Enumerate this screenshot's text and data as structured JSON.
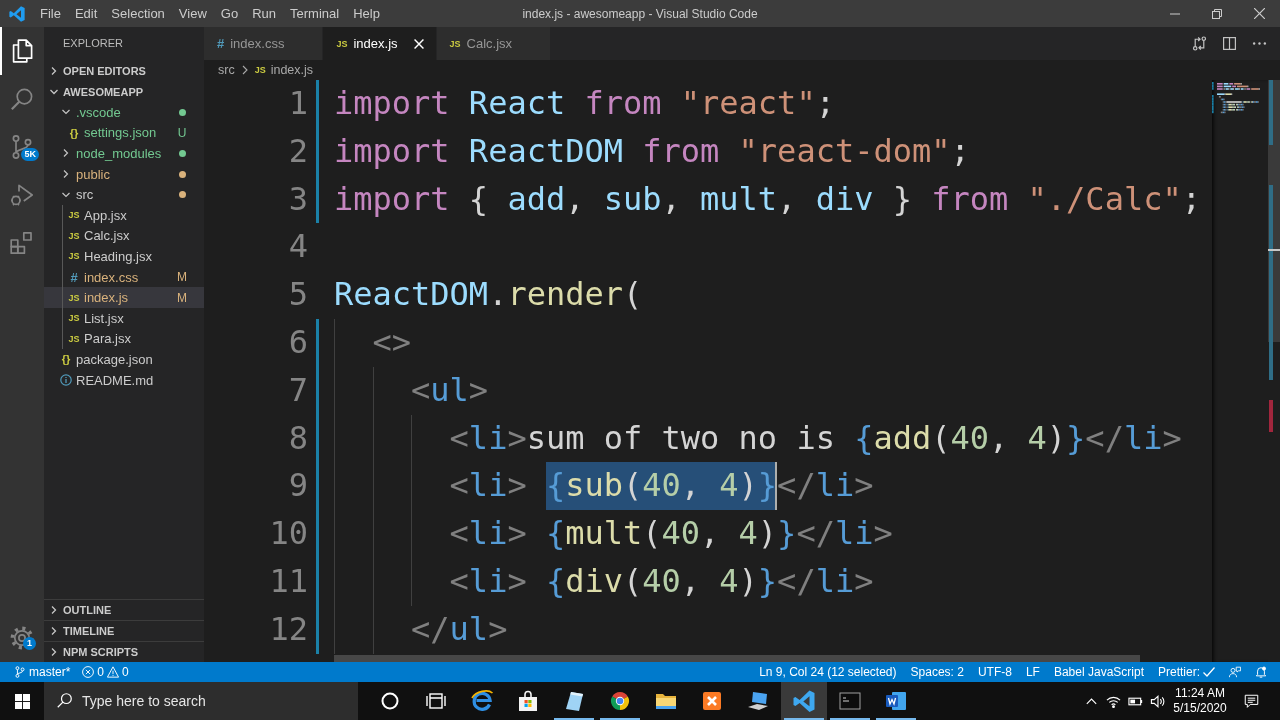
{
  "title_bar": {
    "menus": [
      "File",
      "Edit",
      "Selection",
      "View",
      "Go",
      "Run",
      "Terminal",
      "Help"
    ],
    "title": "index.js - awesomeapp - Visual Studio Code"
  },
  "activity_bar": {
    "top": [
      {
        "kind": "explorer",
        "selected": true
      },
      {
        "kind": "search",
        "selected": false
      },
      {
        "kind": "source-control",
        "selected": false,
        "badge": "5K"
      },
      {
        "kind": "run",
        "selected": false
      },
      {
        "kind": "extensions",
        "selected": false
      }
    ],
    "bottom": [
      {
        "kind": "settings",
        "selected": false,
        "badge": "1"
      }
    ]
  },
  "sidebar": {
    "title": "EXPLORER",
    "sections": [
      {
        "title": "OPEN EDITORS",
        "expanded": false
      },
      {
        "title": "AWESOMEAPP",
        "expanded": true,
        "items": [
          {
            "name": ".vscode",
            "kind": "folder",
            "expanded": true,
            "selected": false,
            "color": "#73c991",
            "dot": {
              "color": "#73c991"
            },
            "children": [
              {
                "name": "settings.json",
                "kind": "json",
                "icon": "{}",
                "selected": false,
                "color": "#73c991",
                "badge": "U"
              }
            ]
          },
          {
            "name": "node_modules",
            "kind": "folder",
            "expanded": false,
            "selected": false,
            "color": "#73c991",
            "dot": {
              "color": "#73c991"
            }
          },
          {
            "name": "public",
            "kind": "folder",
            "expanded": false,
            "selected": false,
            "color": "#d9b27c",
            "dot": {
              "color": "#d9b27c"
            }
          },
          {
            "name": "src",
            "kind": "folder",
            "expanded": true,
            "selected": false,
            "dot": {
              "color": "#d9b27c"
            },
            "children": [
              {
                "name": "App.jsx",
                "kind": "js",
                "icon": "JS",
                "selected": false
              },
              {
                "name": "Calc.jsx",
                "kind": "js",
                "icon": "JS",
                "selected": false
              },
              {
                "name": "Heading.jsx",
                "kind": "js",
                "icon": "JS",
                "selected": false
              },
              {
                "name": "index.css",
                "kind": "css",
                "icon": "#",
                "selected": false,
                "color": "#d9b27c",
                "badge": "M"
              },
              {
                "name": "index.js",
                "kind": "js",
                "icon": "JS",
                "selected": true,
                "color": "#d9b27c",
                "badge": "M"
              },
              {
                "name": "List.jsx",
                "kind": "js",
                "icon": "JS",
                "selected": false
              },
              {
                "name": "Para.jsx",
                "kind": "js",
                "icon": "JS",
                "selected": false
              }
            ]
          },
          {
            "name": "package.json",
            "kind": "json",
            "icon": "{}",
            "selected": false
          },
          {
            "name": "README.md",
            "kind": "info",
            "selected": false
          }
        ]
      },
      {
        "title": "OUTLINE",
        "expanded": false
      },
      {
        "title": "TIMELINE",
        "expanded": false
      },
      {
        "title": "NPM SCRIPTS",
        "expanded": false
      }
    ]
  },
  "editor": {
    "tabs": [
      {
        "icon": "#",
        "kind": "css",
        "label": "index.css",
        "selected": false
      },
      {
        "icon": "JS",
        "kind": "js",
        "label": "index.js",
        "selected": true
      },
      {
        "icon": "JS",
        "kind": "js",
        "label": "Calc.jsx",
        "selected": false
      }
    ],
    "actions": [
      {
        "kind": "compare"
      },
      {
        "kind": "split"
      },
      {
        "kind": "more"
      }
    ],
    "breadcrumb": [
      {
        "label": "src",
        "kind": "folder"
      },
      {
        "label": "index.js",
        "kind": "js",
        "icon": "JS"
      }
    ],
    "lines": [
      {
        "number": "1",
        "changed": true,
        "parts": [
          {
            "selected": false,
            "tokens": [
              {
                "text": "import",
                "kind": "keyword"
              },
              {
                "text": " React",
                "kind": "variable"
              },
              {
                "text": " from",
                "kind": "keyword"
              },
              {
                "text": " \"react\"",
                "kind": "string"
              },
              {
                "text": ";",
                "kind": "punct"
              }
            ]
          }
        ]
      },
      {
        "number": "2",
        "changed": true,
        "parts": [
          {
            "selected": false,
            "tokens": [
              {
                "text": "import",
                "kind": "keyword"
              },
              {
                "text": " ReactDOM",
                "kind": "variable"
              },
              {
                "text": " from",
                "kind": "keyword"
              },
              {
                "text": " \"react-dom\"",
                "kind": "string"
              },
              {
                "text": ";",
                "kind": "punct"
              }
            ]
          }
        ]
      },
      {
        "number": "3",
        "changed": true,
        "parts": [
          {
            "selected": false,
            "tokens": [
              {
                "text": "import",
                "kind": "keyword"
              },
              {
                "text": " {",
                "kind": "punct"
              },
              {
                "text": " add",
                "kind": "variable"
              },
              {
                "text": ",",
                "kind": "punct"
              },
              {
                "text": " sub",
                "kind": "variable"
              },
              {
                "text": ",",
                "kind": "punct"
              },
              {
                "text": " mult",
                "kind": "variable"
              },
              {
                "text": ",",
                "kind": "punct"
              },
              {
                "text": " div",
                "kind": "variable"
              },
              {
                "text": " }",
                "kind": "punct"
              },
              {
                "text": " from",
                "kind": "keyword"
              },
              {
                "text": " \"./Calc\"",
                "kind": "string"
              },
              {
                "text": ";",
                "kind": "punct"
              }
            ]
          }
        ]
      },
      {
        "number": "4",
        "changed": false
      },
      {
        "number": "5",
        "changed": false,
        "parts": [
          {
            "selected": false,
            "tokens": [
              {
                "text": "ReactDOM",
                "kind": "variable"
              },
              {
                "text": ".",
                "kind": "punct"
              },
              {
                "text": "render",
                "kind": "function"
              },
              {
                "text": "(",
                "kind": "punct"
              }
            ]
          }
        ]
      },
      {
        "number": "6",
        "changed": true,
        "parts": [
          {
            "selected": false,
            "tokens": [
              {
                "text": "  <>",
                "kind": "bracket"
              }
            ]
          }
        ]
      },
      {
        "number": "7",
        "changed": true,
        "parts": [
          {
            "selected": false,
            "tokens": [
              {
                "text": "    <",
                "kind": "bracket"
              },
              {
                "text": "ul",
                "kind": "tag"
              },
              {
                "text": ">",
                "kind": "bracket"
              }
            ]
          }
        ]
      },
      {
        "number": "8",
        "changed": true,
        "parts": [
          {
            "selected": false,
            "tokens": [
              {
                "text": "      <",
                "kind": "bracket"
              },
              {
                "text": "li",
                "kind": "tag"
              },
              {
                "text": ">",
                "kind": "bracket"
              },
              {
                "text": "sum of two no is ",
                "kind": "text"
              },
              {
                "text": "{",
                "kind": "brace"
              },
              {
                "text": "add",
                "kind": "function"
              },
              {
                "text": "(",
                "kind": "punct"
              },
              {
                "text": "40",
                "kind": "number"
              },
              {
                "text": ",",
                "kind": "punct"
              },
              {
                "text": " 4",
                "kind": "number"
              },
              {
                "text": ")",
                "kind": "punct"
              },
              {
                "text": "}",
                "kind": "brace"
              },
              {
                "text": "</",
                "kind": "bracket"
              },
              {
                "text": "li",
                "kind": "tag"
              },
              {
                "text": ">",
                "kind": "bracket"
              }
            ]
          }
        ]
      },
      {
        "number": "9",
        "changed": true,
        "parts": [
          {
            "selected": false,
            "tokens": [
              {
                "text": "      <",
                "kind": "bracket"
              },
              {
                "text": "li",
                "kind": "tag"
              },
              {
                "text": "> ",
                "kind": "bracket"
              }
            ]
          },
          {
            "selected": true,
            "cursor": true,
            "tokens": [
              {
                "text": "{",
                "kind": "brace"
              },
              {
                "text": "sub",
                "kind": "function"
              },
              {
                "text": "(",
                "kind": "punct"
              },
              {
                "text": "40",
                "kind": "number"
              },
              {
                "text": ",",
                "kind": "punct"
              },
              {
                "text": " 4",
                "kind": "number"
              },
              {
                "text": ")",
                "kind": "punct"
              },
              {
                "text": "}",
                "kind": "brace"
              }
            ]
          },
          {
            "selected": false,
            "tokens": [
              {
                "text": "</",
                "kind": "bracket"
              },
              {
                "text": "li",
                "kind": "tag"
              },
              {
                "text": ">",
                "kind": "bracket"
              }
            ]
          }
        ]
      },
      {
        "number": "10",
        "changed": true,
        "parts": [
          {
            "selected": false,
            "tokens": [
              {
                "text": "      <",
                "kind": "bracket"
              },
              {
                "text": "li",
                "kind": "tag"
              },
              {
                "text": "> ",
                "kind": "bracket"
              },
              {
                "text": "{",
                "kind": "brace"
              },
              {
                "text": "mult",
                "kind": "function"
              },
              {
                "text": "(",
                "kind": "punct"
              },
              {
                "text": "40",
                "kind": "number"
              },
              {
                "text": ",",
                "kind": "punct"
              },
              {
                "text": " 4",
                "kind": "number"
              },
              {
                "text": ")",
                "kind": "punct"
              },
              {
                "text": "}",
                "kind": "brace"
              },
              {
                "text": "</",
                "kind": "bracket"
              },
              {
                "text": "li",
                "kind": "tag"
              },
              {
                "text": ">",
                "kind": "bracket"
              }
            ]
          }
        ]
      },
      {
        "number": "11",
        "changed": true,
        "parts": [
          {
            "selected": false,
            "tokens": [
              {
                "text": "      <",
                "kind": "bracket"
              },
              {
                "text": "li",
                "kind": "tag"
              },
              {
                "text": "> ",
                "kind": "bracket"
              },
              {
                "text": "{",
                "kind": "brace"
              },
              {
                "text": "div",
                "kind": "function"
              },
              {
                "text": "(",
                "kind": "punct"
              },
              {
                "text": "40",
                "kind": "number"
              },
              {
                "text": ",",
                "kind": "punct"
              },
              {
                "text": " 4",
                "kind": "number"
              },
              {
                "text": ")",
                "kind": "punct"
              },
              {
                "text": "}",
                "kind": "brace"
              },
              {
                "text": "</",
                "kind": "bracket"
              },
              {
                "text": "li",
                "kind": "tag"
              },
              {
                "text": ">",
                "kind": "bracket"
              }
            ]
          }
        ]
      },
      {
        "number": "12",
        "changed": true,
        "parts": [
          {
            "selected": false,
            "tokens": [
              {
                "text": "    </",
                "kind": "bracket"
              },
              {
                "text": "ul",
                "kind": "tag"
              },
              {
                "text": ">",
                "kind": "bracket"
              }
            ]
          }
        ]
      }
    ]
  },
  "status_bar": {
    "left": [
      {
        "kind": "branch",
        "text": "master*"
      },
      {
        "kind": "problems",
        "errors": "0",
        "warnings": "0"
      }
    ],
    "right": [
      {
        "kind": "text",
        "text": "Ln 9, Col 24 (12 selected)"
      },
      {
        "kind": "text",
        "text": "Spaces: 2"
      },
      {
        "kind": "text",
        "text": "UTF-8"
      },
      {
        "kind": "text",
        "text": "LF"
      },
      {
        "kind": "text",
        "text": "Babel JavaScript"
      },
      {
        "kind": "check",
        "text": "Prettier:"
      },
      {
        "kind": "feedback"
      },
      {
        "kind": "bell"
      }
    ]
  },
  "taskbar": {
    "search": {
      "placeholder": "Type here to search"
    },
    "apps": [
      {
        "kind": "circle",
        "running": false,
        "selected": false
      },
      {
        "kind": "task-view",
        "running": false,
        "selected": false
      },
      {
        "kind": "e-browser",
        "running": false,
        "selected": false
      },
      {
        "kind": "store",
        "running": false,
        "selected": false
      },
      {
        "kind": "page",
        "running": true,
        "selected": false
      },
      {
        "kind": "round-browser",
        "running": true,
        "selected": false
      },
      {
        "kind": "folder",
        "running": false,
        "selected": false
      },
      {
        "kind": "tile",
        "running": false,
        "selected": false
      },
      {
        "kind": "laptop",
        "running": false,
        "selected": false
      },
      {
        "kind": "editor",
        "running": true,
        "selected": true
      },
      {
        "kind": "terminal",
        "running": true,
        "selected": false
      },
      {
        "kind": "document",
        "running": true,
        "selected": false
      }
    ],
    "tray": [
      {
        "kind": "chevron"
      },
      {
        "kind": "wifi"
      },
      {
        "kind": "battery"
      },
      {
        "kind": "volume"
      }
    ],
    "time": "11:24 AM",
    "date": "5/15/2020"
  }
}
